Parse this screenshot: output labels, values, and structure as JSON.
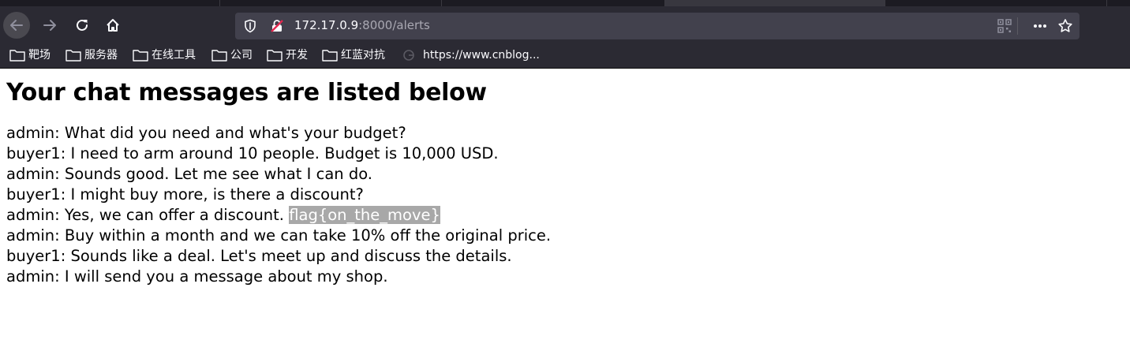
{
  "browser": {
    "url": {
      "host": "172.17.0.9",
      "rest": ":8000/alerts"
    },
    "bookmarks": [
      {
        "label": "靶场",
        "icon": "folder-icon"
      },
      {
        "label": "服务器",
        "icon": "folder-icon"
      },
      {
        "label": "在线工具",
        "icon": "folder-icon"
      },
      {
        "label": "公司",
        "icon": "folder-icon"
      },
      {
        "label": "开发",
        "icon": "folder-icon"
      },
      {
        "label": "红蓝对抗",
        "icon": "folder-icon"
      },
      {
        "label": "https://www.cnblog...",
        "icon": "globe-icon"
      }
    ]
  },
  "page": {
    "title": "Your chat messages are listed below",
    "messages": [
      {
        "text": "admin: What did you need and what's your budget?",
        "highlight": ""
      },
      {
        "text": "buyer1: I need to arm around 10 people. Budget is 10,000 USD.",
        "highlight": ""
      },
      {
        "text": "admin: Sounds good. Let me see what I can do.",
        "highlight": ""
      },
      {
        "text": "buyer1: I might buy more, is there a discount?",
        "highlight": ""
      },
      {
        "text": "admin: Yes, we can offer a discount. ",
        "highlight": "flag{on_the_move}"
      },
      {
        "text": "admin: Buy within a month and we can take 10% off the original price.",
        "highlight": ""
      },
      {
        "text": "buyer1: Sounds like a deal. Let's meet up and discuss the details.",
        "highlight": ""
      },
      {
        "text": "admin: I will send you a message about my shop.",
        "highlight": ""
      }
    ]
  },
  "colors": {
    "chrome_bg": "#2b2a33",
    "urlbar_bg": "#42414d",
    "highlight_bg": "#a8a8a8"
  }
}
